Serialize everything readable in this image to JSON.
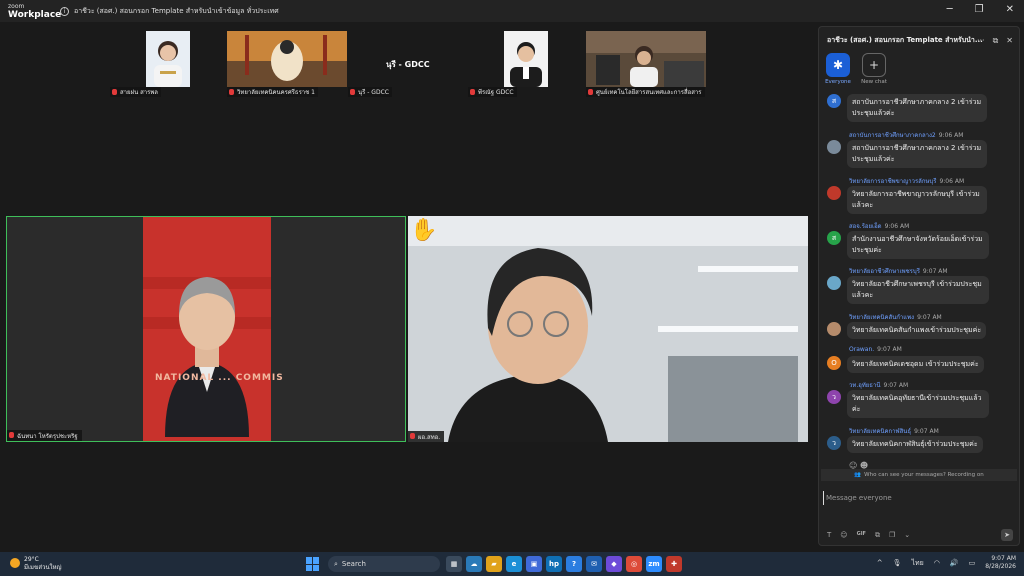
{
  "app": {
    "brand_top": "zoom",
    "brand_main": "Workplace",
    "meeting_title": "อาชีวะ (สอศ.) สอนกรอก Template สำหรับนำเข้าข้อมูล ทั่วประเทศ"
  },
  "window_controls": {
    "minimize": "─",
    "maximize": "❐",
    "close": "✕"
  },
  "thumbnails": [
    {
      "name": "สายฝน สารพล",
      "muted": true
    },
    {
      "name": "วิทยาลัยเทคนิคนครศรีธราช 1",
      "muted": true
    },
    {
      "name": "นุรี - GDCC",
      "muted": true,
      "caption": "นุรี - GDCC"
    },
    {
      "name": "พีรณัฐ GDCC",
      "muted": true
    },
    {
      "name": "ศูนย์เทคโนโลยีสารสนเทศและการสื่อสาร",
      "muted": true
    }
  ],
  "main_tiles": [
    {
      "name": "ฉันทนา โหรัตรุปชะหริฐ",
      "muted": true,
      "background_text": "NATIONAL ... COMMIS"
    },
    {
      "name": "ผอ.สทอ.",
      "muted": true,
      "raised_hand": "✋"
    }
  ],
  "chat": {
    "title": "อาชีวะ (สอศ.) สอนกรอก Template สำหรับนำ...",
    "header_icons": {
      "more": "···",
      "popout": "⧉",
      "close": "✕"
    },
    "tabs": [
      {
        "label": "Everyone",
        "icon": "✱"
      },
      {
        "label": "New chat",
        "icon": "+"
      }
    ],
    "messages": [
      {
        "sender": "",
        "time": "",
        "avatar": "ส",
        "avatar_color": "#2f6fd1",
        "text": "สถาบันการอาชีวศึกษาภาคกลาง 2 เข้าร่วมประชุมแล้วค่ะ"
      },
      {
        "sender": "สถาบันการอาชีวศึกษาภาคกลาง2",
        "time": "9:06 AM",
        "avatar": "",
        "avatar_color": "#7a8a9a",
        "text": "สถาบันการอาชีวศึกษาภาคกลาง 2 เข้าร่วมประชุมแล้วค่ะ"
      },
      {
        "sender": "วิทยาลัยการอาชีพขาญาวรลักษบุรี",
        "time": "9:06 AM",
        "avatar": "",
        "avatar_color": "#c0392b",
        "text": "วิทยาลัยการอาชีพขาญาวรลักษบุรี เข้าร่วมแล้วคะ"
      },
      {
        "sender": "สอจ.ร้อยเอ็ด",
        "time": "9:06 AM",
        "avatar": "ส",
        "avatar_color": "#27a34a",
        "text": "สำนักงานอาชีวศึกษาจังหวัดร้อยเอ็ดเข้าร่วมประชุมค่ะ"
      },
      {
        "sender": "วิทยาลัยอาชีวศึกษาเพชรบุรี",
        "time": "9:07 AM",
        "avatar": "",
        "avatar_color": "#6aa7c9",
        "text": "วิทยาลัยอาชีวศึกษาเพชรบุรี เข้าร่วมประชุมแล้วคะ"
      },
      {
        "sender": "วิทยาลัยเทคนิคสันกำแพง",
        "time": "9:07 AM",
        "avatar": "",
        "avatar_color": "#b58b6b",
        "text": "วิทยาลัยเทคนิคสันกำแพงเข้าร่วมประชุมค่ะ"
      },
      {
        "sender": "Orawan.",
        "time": "9:07 AM",
        "avatar": "O",
        "avatar_color": "#e67e22",
        "text": "วิทยาลัยเทคนิคเดชอุดม เข้าร่วมประชุมค่ะ"
      },
      {
        "sender": "วท.อุทัยธานี",
        "time": "9:07 AM",
        "avatar": "ว",
        "avatar_color": "#8e44ad",
        "text": "วิทยาลัยเทคนิคอุทัยธานีเข้าร่วมประชุมแล้วค่ะ"
      },
      {
        "sender": "วิทยาลัยเทคนิคกาฬสินธุ์",
        "time": "9:07 AM",
        "avatar": "ว",
        "avatar_color": "#2c5d8a",
        "text": "วิทยาลัยเทคนิคกาฬสินธุ์เข้าร่วมประชุมค่ะ"
      }
    ],
    "visibility_notice": "Who can see your messages? Recording on",
    "composer_placeholder": "Message everyone",
    "tools": {
      "format": "T",
      "emoji": "☺",
      "gif": "GIF",
      "screenshot": "⧉",
      "file": "❐",
      "more": "⌄"
    },
    "send_icon": "➤"
  },
  "taskbar": {
    "weather_temp": "29°C",
    "weather_desc": "มีเมฆส่วนใหญ่",
    "search_label": "Search",
    "apps": [
      {
        "label": "▦",
        "color": "#3a4a5c"
      },
      {
        "label": "☁",
        "color": "#2a7ab8"
      },
      {
        "label": "▰",
        "color": "#e0a21a"
      },
      {
        "label": "e",
        "color": "#1b8fd6"
      },
      {
        "label": "▣",
        "color": "#3f6ad8"
      },
      {
        "label": "hp",
        "color": "#0f6fb5"
      },
      {
        "label": "?",
        "color": "#2b7de0"
      },
      {
        "label": "✉",
        "color": "#1f5fb0"
      },
      {
        "label": "◆",
        "color": "#6d4bd8"
      },
      {
        "label": "◎",
        "color": "#dd4b39"
      },
      {
        "label": "zm",
        "color": "#2d8cff"
      },
      {
        "label": "✚",
        "color": "#c0392b"
      }
    ],
    "tray_chevron": "^",
    "tray_language": "ไทย",
    "time": "9:07 AM",
    "date": "8/28/2026"
  }
}
